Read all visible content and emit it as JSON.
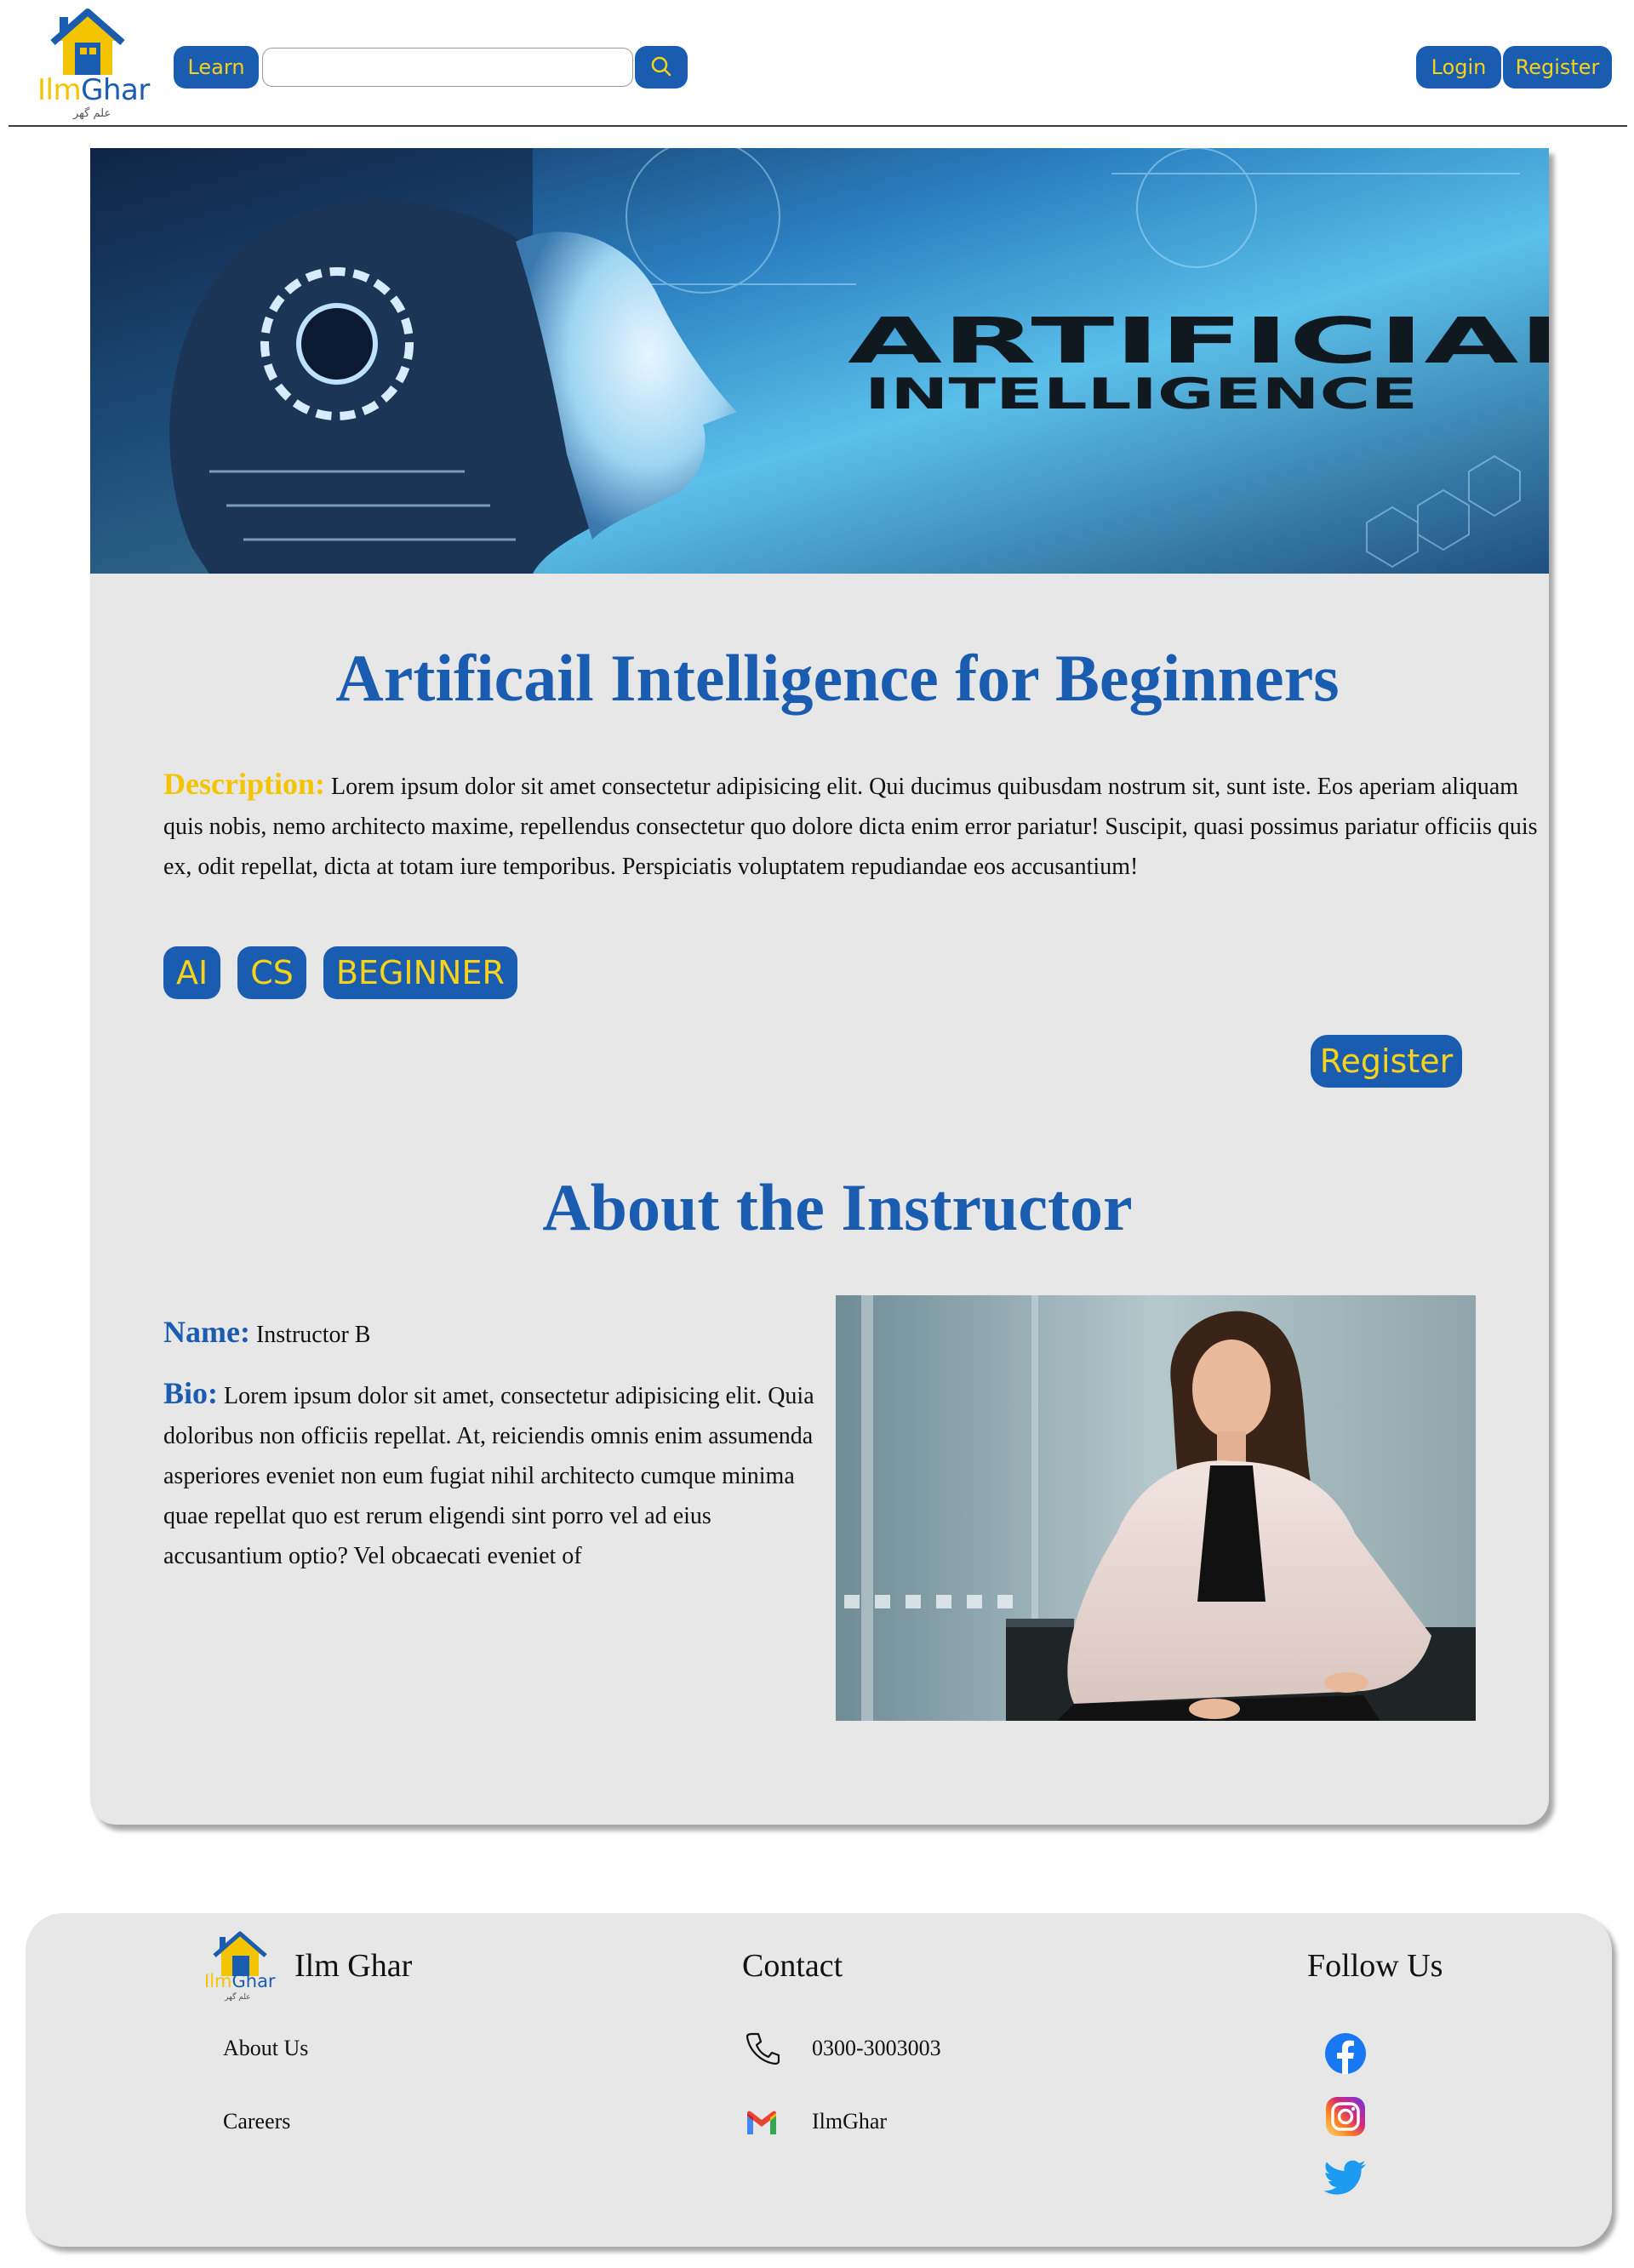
{
  "header": {
    "logo": {
      "word_part1": "Ilm",
      "word_part2": "Ghar",
      "urdu": "علم گھر"
    },
    "learn_label": "Learn",
    "search": {
      "value": "",
      "placeholder": ""
    },
    "login_label": "Login",
    "register_label": "Register"
  },
  "colors": {
    "brand_blue": "#1a5cb0",
    "brand_yellow": "#f5c400",
    "card_bg": "#e7e7e8"
  },
  "course": {
    "banner": {
      "line1": "ARTIFICIAL",
      "line2": "INTELLIGENCE"
    },
    "title": "Artificail Intelligence for Beginners",
    "description_label": "Description:",
    "description": "Lorem ipsum dolor sit amet consectetur adipisicing elit. Qui ducimus quibusdam nostrum sit, sunt iste. Eos aperiam aliquam quis nobis, nemo architecto maxime, repellendus consectetur quo dolore dicta enim error pariatur! Suscipit, quasi possimus pariatur officiis quis ex, odit repellat, dicta at totam iure temporibus. Perspiciatis voluptatem repudiandae eos accusantium!",
    "tags": [
      "AI",
      "CS",
      "BEGINNER"
    ],
    "register_label": "Register"
  },
  "instructor": {
    "section_title": "About the Instructor",
    "name_label": "Name:",
    "name": "Instructor B",
    "bio_label": "Bio:",
    "bio": "Lorem ipsum dolor sit amet, consectetur adipisicing elit. Quia doloribus non officiis repellat. At, reiciendis omnis enim assumenda asperiores eveniet non eum fugiat nihil architecto cumque minima quae repellat quo est rerum eligendi sint porro vel ad eius accusantium optio? Vel obcaecati eveniet of"
  },
  "footer": {
    "brand": "Ilm Ghar",
    "logo": {
      "word_part1": "Ilm",
      "word_part2": "Ghar",
      "urdu": "علم گھر"
    },
    "links": [
      "About Us",
      "Careers"
    ],
    "contact_heading": "Contact",
    "phone": "0300-3003003",
    "email": "IlmGhar",
    "follow_heading": "Follow Us",
    "social_icons": [
      "facebook-icon",
      "instagram-icon",
      "twitter-icon"
    ]
  }
}
